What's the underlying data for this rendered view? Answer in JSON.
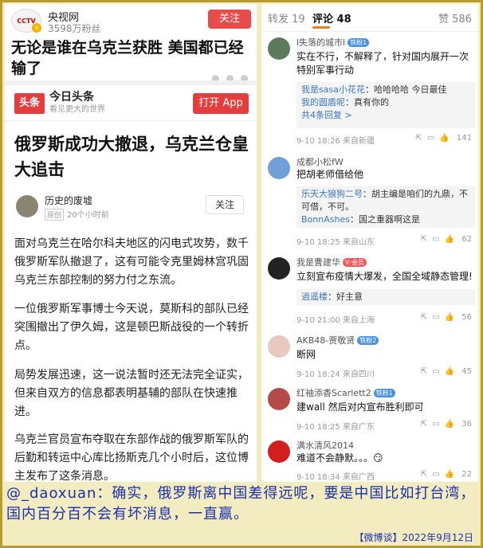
{
  "card1": {
    "account_name": "央视网",
    "logo_text": "CCTV",
    "fans": "3598万粉丝",
    "follow_label": "关注",
    "title": "无论是谁在乌克兰获胜 美国都已经输了"
  },
  "card2": {
    "app_logo": "头条",
    "app_name": "今日头条",
    "slogan": "看见更大的世界",
    "open_label": "打开 App",
    "article_title": "俄罗斯成功大撤退，乌克兰仓皇大追击",
    "author": "历史的废墟",
    "author_tag": "原创",
    "author_time": "20个小时前",
    "follow_label": "关注",
    "paragraphs": [
      "面对乌克兰在哈尔科夫地区的闪电式攻势，数千俄罗斯军队撤退了，这有可能令克里姆林宫巩固乌克兰东部控制的努力付之东流。",
      "一位俄罗斯军事博士今天说，莫斯科的部队已经突围撤出了伊久姆，这是顿巴斯战役的一个转折点。",
      "局势发展迅速，这一说法暂时还无法完全证实，但来自双方的信息都表明基辅的部队在快速推进。",
      "乌克兰官员宣布夺取在东部作战的俄罗斯军队的后勤和转运中心库比扬斯克几个小时后，这位博主发布了这条消息。"
    ]
  },
  "comments_panel": {
    "tabs": {
      "repost": "转发 19",
      "comment": "评论 48",
      "like": "赞 586"
    },
    "comments": [
      {
        "name": "l失落的城市l",
        "badge": "铁粉1",
        "text": "实在不行，不解释了，针对国内展开一次特别军事行动",
        "replies": [
          {
            "name": "我是sasa小花花",
            "text": "哈哈哈哈 今日最佳"
          },
          {
            "name": "我的圆盾呢",
            "text": "真有你的"
          }
        ],
        "more": "共4条回复 >",
        "meta": "9-10 18:26  来自新疆",
        "likes": "141"
      },
      {
        "name": "成都小松fW",
        "text": "把胡老师借给他",
        "replies": [
          {
            "name": "乐天大狼狗二号",
            "text": "胡主编是咱们的九鼎，不可借，不可。"
          },
          {
            "name": "BonnAshes",
            "text": "国之重器啊这是"
          }
        ],
        "meta": "9-10 18:25  来自山东",
        "likes": "62"
      },
      {
        "name": "我是曹建华",
        "badge": "V·会员",
        "text": "立刻宣布疫情大爆发，全国全域静态管理!",
        "replies": [
          {
            "name": "逍遥楼",
            "text": "好主意"
          }
        ],
        "meta": "9-10 21:00  来自上海",
        "likes": "56"
      },
      {
        "name": "AKB48-贾敬贤",
        "badge": "铁粉2",
        "text": "断网",
        "meta": "9-10 18:24  来自四川",
        "likes": "45"
      },
      {
        "name": "红袖添香Scarlett2",
        "badge": "铁粉1",
        "text": "建wall 然后对内宣布胜利即可",
        "meta": "9-10 18:25  来自广东",
        "likes": "36"
      },
      {
        "name": "满水清风2014",
        "text": "难道不会静默。。。😏",
        "meta": "9-10 18:34  来自广西",
        "likes": "22"
      }
    ]
  },
  "caption": "@_daoxuan：确实，俄罗斯离中国差得远呢，要是中国比如打台湾，国内百分百不会有坏消息，一直赢。",
  "footer": "【微博谈】2022年9月12日",
  "colors": {
    "accent_red": "#e43d3d",
    "tab_orange": "#f07d1a",
    "link_blue": "#3a74c4",
    "caption_blue": "#1a2fb0",
    "frame_gold": "#b89c2e"
  }
}
